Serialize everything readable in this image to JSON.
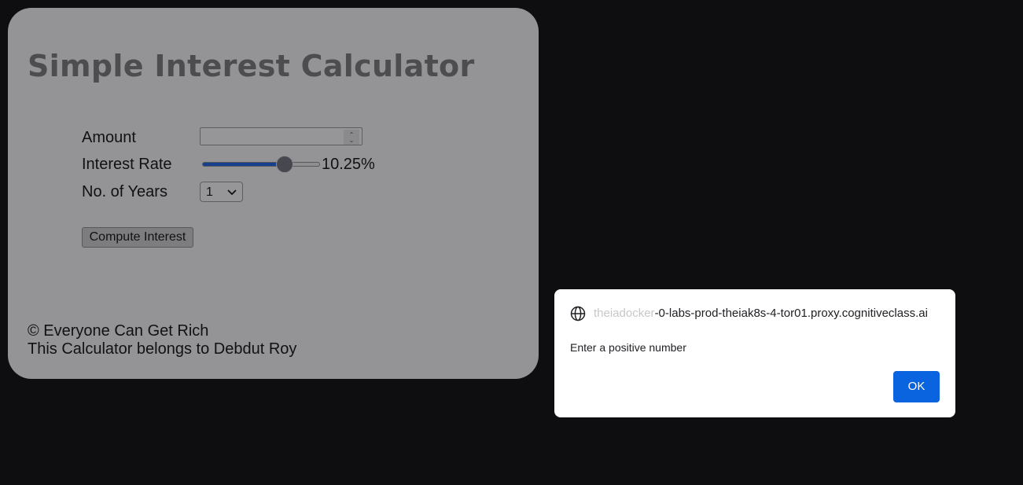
{
  "calculator": {
    "title": "Simple Interest Calculator",
    "amount_label": "Amount",
    "amount_value": "",
    "rate_label": "Interest Rate",
    "rate_fraction": 0.7,
    "rate_display": "10.25%",
    "years_label": "No. of Years",
    "years_value": "1",
    "compute_label": "Compute Interest",
    "footer_line1": "© Everyone Can Get Rich",
    "footer_line2": "This Calculator belongs to Debdut Roy",
    "slider_color": "#163f8e"
  },
  "dialog": {
    "origin_faded": "theiadocker",
    "origin_rest": "-0-labs-prod-theiak8s-4-tor01.proxy.cognitiveclass.ai",
    "message": "Enter a positive number",
    "ok_label": "OK",
    "ok_color": "#0a64e0",
    "icon": "globe-icon"
  }
}
